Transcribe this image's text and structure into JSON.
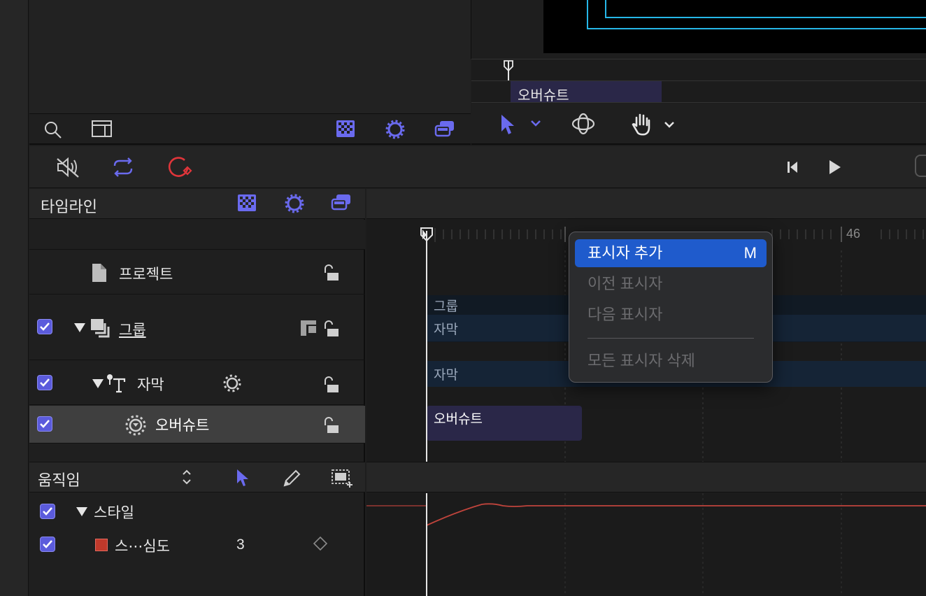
{
  "canvas": {
    "timing_label": "오버슈트"
  },
  "timeline_panel": {
    "title": "타임라인",
    "rows": [
      {
        "label": "프로젝트"
      },
      {
        "label": "그룹"
      },
      {
        "label": "자막"
      },
      {
        "label": "오버슈트"
      }
    ]
  },
  "ruler": {
    "tick_46": "46"
  },
  "tracks": {
    "group": "그룹",
    "caption_1": "자막",
    "caption_2": "자막",
    "overshoot": "오버슈트"
  },
  "context_menu": {
    "items": [
      {
        "label": "표시자 추가",
        "shortcut": "M",
        "enabled": true,
        "highlighted": true
      },
      {
        "label": "이전 표시자",
        "enabled": false
      },
      {
        "label": "다음 표시자",
        "enabled": false
      },
      {
        "label": "모든 표시자 삭제",
        "enabled": false
      }
    ]
  },
  "keyframe_editor": {
    "title": "움직임",
    "rows": [
      {
        "label": "스타일"
      },
      {
        "label": "스⋯심도",
        "value": "3"
      }
    ]
  },
  "colors": {
    "accent": "#5b5bdc",
    "record": "#e0353a",
    "menu_highlight": "#1f5bcc",
    "track_blue": "#152436",
    "track_purple": "#2a2748"
  }
}
